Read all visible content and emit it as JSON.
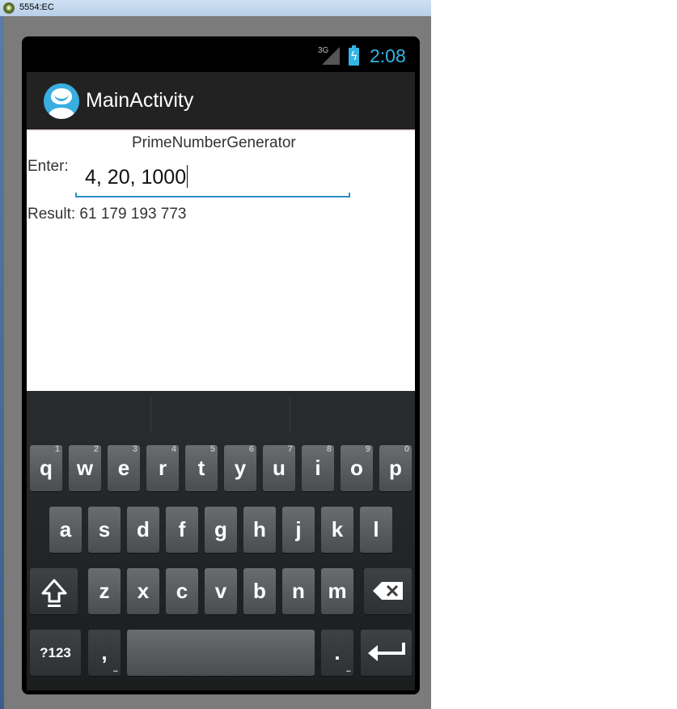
{
  "window": {
    "title": "5554:EC"
  },
  "status_bar": {
    "network": "3G",
    "time": "2:08"
  },
  "action_bar": {
    "title": "MainActivity",
    "icon": "app-face-icon"
  },
  "content": {
    "header": "PrimeNumberGenerator",
    "enter_label": "Enter:",
    "input_value": "4, 20, 1000",
    "result": "Result: 61 179 193 773"
  },
  "keyboard": {
    "row1": [
      {
        "label": "q",
        "hint": "1"
      },
      {
        "label": "w",
        "hint": "2"
      },
      {
        "label": "e",
        "hint": "3"
      },
      {
        "label": "r",
        "hint": "4"
      },
      {
        "label": "t",
        "hint": "5"
      },
      {
        "label": "y",
        "hint": "6"
      },
      {
        "label": "u",
        "hint": "7"
      },
      {
        "label": "i",
        "hint": "8"
      },
      {
        "label": "o",
        "hint": "9"
      },
      {
        "label": "p",
        "hint": "0"
      }
    ],
    "row2": [
      "a",
      "s",
      "d",
      "f",
      "g",
      "h",
      "j",
      "k",
      "l"
    ],
    "row3": [
      "z",
      "x",
      "c",
      "v",
      "b",
      "n",
      "m"
    ],
    "symbols_label": "?123",
    "comma_label": ",",
    "period_label": ".",
    "more_dots": "...",
    "icons": {
      "shift": "shift-icon",
      "backspace": "backspace-icon",
      "enter": "enter-icon"
    },
    "colors": {
      "accent": "#33b5e5",
      "key": "#5a5d60",
      "background": "#222222"
    }
  }
}
